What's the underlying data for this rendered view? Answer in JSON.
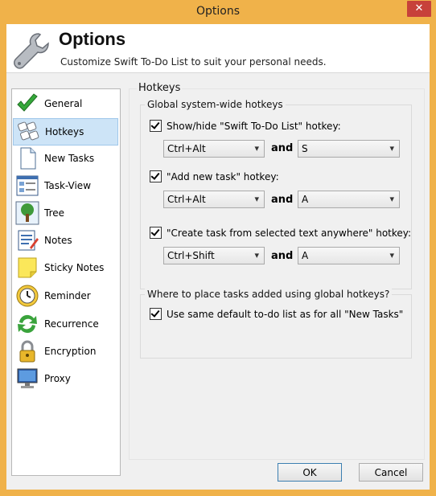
{
  "window": {
    "title": "Options",
    "close_glyph": "✕"
  },
  "header": {
    "title": "Options",
    "subtitle": "Customize Swift To-Do List to suit your personal needs.",
    "icon": "wrench-icon"
  },
  "nav": {
    "items": [
      {
        "label": "General",
        "icon": "checkmark-icon"
      },
      {
        "label": "Hotkeys",
        "icon": "keyboard-icon",
        "selected": true
      },
      {
        "label": "New Tasks",
        "icon": "document-icon"
      },
      {
        "label": "Task-View",
        "icon": "window-icon"
      },
      {
        "label": "Tree",
        "icon": "tree-icon"
      },
      {
        "label": "Notes",
        "icon": "notes-icon"
      },
      {
        "label": "Sticky Notes",
        "icon": "sticky-note-icon"
      },
      {
        "label": "Reminder",
        "icon": "clock-icon"
      },
      {
        "label": "Recurrence",
        "icon": "recurrence-icon"
      },
      {
        "label": "Encryption",
        "icon": "lock-icon"
      },
      {
        "label": "Proxy",
        "icon": "computer-icon"
      }
    ]
  },
  "panel": {
    "title": "Hotkeys",
    "global_group": {
      "title": "Global system-wide hotkeys",
      "hotkeys": [
        {
          "label": "Show/hide \"Swift To-Do List\" hotkey:",
          "checked": true,
          "modifier": "Ctrl+Alt",
          "key": "S"
        },
        {
          "label": "\"Add new task\" hotkey:",
          "checked": true,
          "modifier": "Ctrl+Alt",
          "key": "A"
        },
        {
          "label": "\"Create task from selected text anywhere\" hotkey:",
          "checked": true,
          "modifier": "Ctrl+Shift",
          "key": "A"
        }
      ],
      "and_label": "and"
    },
    "place_group": {
      "title": "Where to place tasks added using global hotkeys?",
      "option_label": "Use same default to-do list as for all \"New Tasks\"",
      "option_checked": true
    }
  },
  "footer": {
    "ok_label": "OK",
    "cancel_label": "Cancel"
  }
}
